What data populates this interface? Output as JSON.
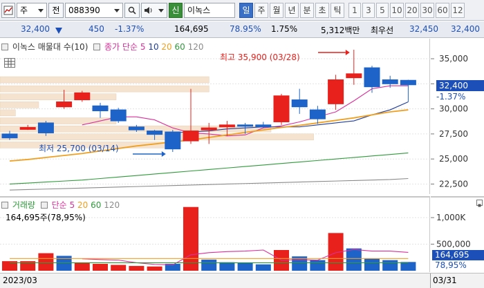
{
  "toolbar": {
    "type_label": "주",
    "prev_label": "전",
    "code": "088390",
    "credit_badge": "신",
    "stock_name": "이녹스",
    "periods": [
      "일",
      "주",
      "월",
      "년",
      "분",
      "초",
      "틱"
    ],
    "active_period": "일",
    "numbers": [
      "1",
      "3",
      "5",
      "10",
      "20",
      "30",
      "60",
      "12"
    ]
  },
  "quote": {
    "price": "32,400",
    "change": "450",
    "change_pct": "-1.37%",
    "volume": "164,695",
    "vol_ratio": "78.95%",
    "turnover_pct": "1.75%",
    "amount": "5,312백만",
    "best_label": "최우선",
    "ask": "32,450",
    "bid": "32,400"
  },
  "price_legend": {
    "title": "이녹스 매물대 수(10)",
    "ma_prefix": "종가 단순",
    "ma_periods": [
      "5",
      "10",
      "20",
      "60",
      "120"
    ]
  },
  "annotations": {
    "high": "최고 35,900 (03/28)",
    "low": "최저 25,700 (03/14)"
  },
  "price_axis": {
    "ticks": [
      "35,000",
      "32,500",
      "30,000",
      "27,500",
      "25,000",
      "22,500"
    ],
    "current": "32,400",
    "current_change": "-1.37%"
  },
  "vol_legend": {
    "title": "거래량",
    "ma_prefix": "단순",
    "ma_periods": [
      "5",
      "20",
      "60",
      "120"
    ],
    "summary": "164,695주(78,95%)"
  },
  "vol_axis": {
    "ticks": [
      "1,000K",
      "500,000"
    ],
    "current": "164,695",
    "current_pct": "78,95%"
  },
  "dates": {
    "left": "2023/03",
    "right": "03/31"
  },
  "colors": {
    "up": "#e8211c",
    "down": "#1d63c8",
    "ma5": "#d9309b",
    "ma10": "#1f3d99",
    "ma20": "#f0a020",
    "ma60": "#2e9a3a",
    "ma120": "#8a8a8a",
    "volume_profile": "#f5e3cf"
  },
  "chart_data": [
    {
      "type": "candlestick",
      "title": "이녹스 매물대 수(10)",
      "y_unit": "KRW",
      "ylim": [
        21500,
        37000
      ],
      "series_candles": [
        {
          "o": 27500,
          "h": 27800,
          "l": 26900,
          "c": 27100
        },
        {
          "o": 27950,
          "h": 28400,
          "l": 27900,
          "c": 28150
        },
        {
          "o": 28600,
          "h": 28800,
          "l": 27300,
          "c": 27600
        },
        {
          "o": 30200,
          "h": 31900,
          "l": 30000,
          "c": 30700
        },
        {
          "o": 30900,
          "h": 31800,
          "l": 30700,
          "c": 31600
        },
        {
          "o": 30300,
          "h": 30600,
          "l": 29100,
          "c": 29800
        },
        {
          "o": 29900,
          "h": 30100,
          "l": 28600,
          "c": 28800
        },
        {
          "o": 28200,
          "h": 28400,
          "l": 27700,
          "c": 27900
        },
        {
          "o": 27800,
          "h": 27900,
          "l": 26900,
          "c": 27450
        },
        {
          "o": 27700,
          "h": 27900,
          "l": 25700,
          "c": 26000
        },
        {
          "o": 26800,
          "h": 32000,
          "l": 26500,
          "c": 27800
        },
        {
          "o": 27900,
          "h": 28600,
          "l": 26500,
          "c": 28100
        },
        {
          "o": 28200,
          "h": 28800,
          "l": 27300,
          "c": 28400
        },
        {
          "o": 28400,
          "h": 28600,
          "l": 27500,
          "c": 28300
        },
        {
          "o": 28400,
          "h": 28700,
          "l": 28100,
          "c": 28200
        },
        {
          "o": 28700,
          "h": 31500,
          "l": 28400,
          "c": 31300
        },
        {
          "o": 30900,
          "h": 32000,
          "l": 29500,
          "c": 30200
        },
        {
          "o": 29900,
          "h": 30300,
          "l": 28500,
          "c": 29000
        },
        {
          "o": 30500,
          "h": 33400,
          "l": 29900,
          "c": 32900
        },
        {
          "o": 33100,
          "h": 35900,
          "l": 32400,
          "c": 33500
        },
        {
          "o": 34100,
          "h": 34300,
          "l": 31600,
          "c": 32200
        },
        {
          "o": 32900,
          "h": 33300,
          "l": 32100,
          "c": 32500
        },
        {
          "o": 32850,
          "h": 32900,
          "l": 30700,
          "c": 32400
        }
      ],
      "volume_profile_levels": [
        {
          "price": 32900,
          "rel": 0.54
        },
        {
          "price": 32000,
          "rel": 0.54
        },
        {
          "price": 31200,
          "rel": 0.3
        },
        {
          "price": 30400,
          "rel": 0.1
        },
        {
          "price": 29600,
          "rel": 0.04
        },
        {
          "price": 28800,
          "rel": 0.3
        },
        {
          "price": 28000,
          "rel": 0.7
        },
        {
          "price": 27200,
          "rel": 0.81
        },
        {
          "price": 26400,
          "rel": 0.43
        }
      ],
      "moving_averages": [
        {
          "name": "5",
          "values": [
            null,
            null,
            null,
            null,
            28400,
            28800,
            29200,
            29200,
            28900,
            28100,
            27600,
            27500,
            27300,
            27400,
            28100,
            28300,
            28700,
            29200,
            29700,
            30800,
            32000,
            32300,
            32300
          ]
        },
        {
          "name": "10",
          "values": [
            null,
            null,
            null,
            null,
            null,
            null,
            null,
            null,
            null,
            27600,
            27700,
            27800,
            28000,
            28100,
            28200,
            28200,
            28200,
            28400,
            28600,
            28800,
            29400,
            29900,
            30700
          ]
        },
        {
          "name": "20",
          "values": [
            24800,
            24950,
            25150,
            25350,
            25550,
            25800,
            26050,
            26300,
            26500,
            26700,
            26900,
            27150,
            27400,
            27650,
            27900,
            28150,
            28350,
            28600,
            28850,
            29100,
            29400,
            29700,
            29900
          ]
        },
        {
          "name": "60",
          "values": [
            22500,
            22600,
            22700,
            22800,
            22900,
            23050,
            23200,
            23350,
            23500,
            23650,
            23800,
            23950,
            24100,
            24250,
            24400,
            24550,
            24700,
            24850,
            25000,
            25150,
            25300,
            25450,
            25600
          ]
        },
        {
          "name": "120",
          "values": [
            21900,
            21950,
            22000,
            22050,
            22100,
            22150,
            22200,
            22250,
            22300,
            22350,
            22400,
            22450,
            22500,
            22550,
            22600,
            22650,
            22700,
            22750,
            22800,
            22850,
            22900,
            22950,
            23050
          ]
        }
      ],
      "high": {
        "value": 35900,
        "date": "03/28"
      },
      "low": {
        "value": 25700,
        "date": "03/14"
      }
    },
    {
      "type": "bar",
      "title": "거래량",
      "y_unit": "shares",
      "ylim": [
        0,
        1300000
      ],
      "values": [
        180000,
        180000,
        330000,
        280000,
        150000,
        130000,
        110000,
        90000,
        80000,
        130000,
        1200000,
        210000,
        160000,
        150000,
        120000,
        390000,
        270000,
        200000,
        710000,
        420000,
        230000,
        200000,
        164695
      ],
      "up_flags": [
        true,
        true,
        true,
        false,
        true,
        true,
        true,
        true,
        true,
        false,
        true,
        false,
        false,
        false,
        false,
        true,
        false,
        false,
        true,
        false,
        false,
        false,
        false
      ],
      "moving_averages": [
        {
          "name": "5",
          "values": [
            null,
            null,
            null,
            null,
            225000,
            210000,
            200000,
            150000,
            120000,
            110000,
            300000,
            340000,
            360000,
            370000,
            390000,
            200000,
            210000,
            200000,
            340000,
            400000,
            370000,
            370000,
            345000
          ]
        },
        {
          "name": "20",
          "values": [
            230000,
            230000,
            230000,
            230000,
            230000,
            230000,
            230000,
            230000,
            230000,
            230000,
            230000,
            230000,
            230000,
            230000,
            230000,
            230000,
            230000,
            230000,
            230000,
            230000,
            230000,
            230000,
            230000
          ]
        },
        {
          "name": "60",
          "values": [
            150000,
            150000,
            150000,
            150000,
            150000,
            150000,
            150000,
            150000,
            150000,
            150000,
            150000,
            150000,
            150000,
            150000,
            150000,
            150000,
            150000,
            150000,
            150000,
            150000,
            150000,
            150000,
            150000
          ]
        }
      ]
    }
  ]
}
